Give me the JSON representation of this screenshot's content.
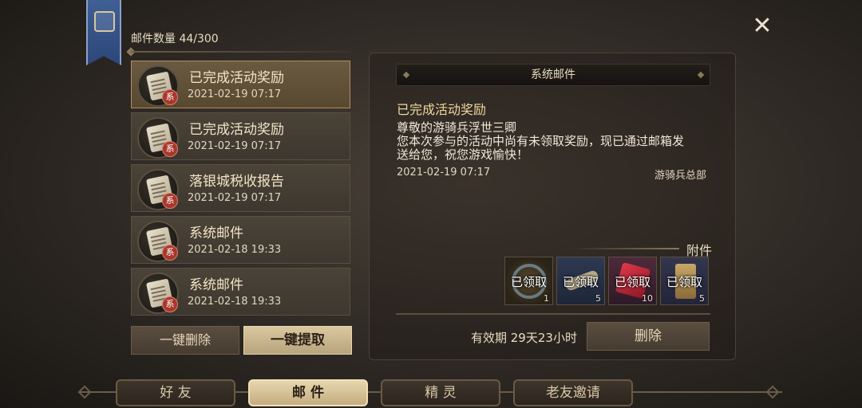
{
  "mail_count": "邮件数量 44/300",
  "mail_list": [
    {
      "title": "已完成活动奖励",
      "date": "2021-02-19 07:17",
      "badge": "系"
    },
    {
      "title": "已完成活动奖励",
      "date": "2021-02-19 07:17",
      "badge": "系"
    },
    {
      "title": "落银城税收报告",
      "date": "2021-02-19 07:17",
      "badge": "系"
    },
    {
      "title": "系统邮件",
      "date": "2021-02-18 19:33",
      "badge": "系"
    },
    {
      "title": "系统邮件",
      "date": "2021-02-18 19:33",
      "badge": "系"
    }
  ],
  "list_buttons": {
    "delete_all": "一键删除",
    "claim_all": "一键提取"
  },
  "detail": {
    "header": "系统邮件",
    "title": "已完成活动奖励",
    "body": [
      "尊敬的游骑兵浮世三卿",
      "您本次参与的活动中尚有未领取奖励，现已通过邮箱发",
      "送给您，祝您游戏愉快！"
    ],
    "date": "2021-02-19 07:17",
    "sender": "游骑兵总部",
    "attachment_label": "附件",
    "rewards": [
      {
        "status": "已领取",
        "qty": "1",
        "icon": "ring-icon",
        "color": "#3a3020"
      },
      {
        "status": "已领取",
        "qty": "5",
        "icon": "scroll-item-icon",
        "color": "#2a3548"
      },
      {
        "status": "已领取",
        "qty": "10",
        "icon": "gem-icon",
        "color": "#4a2838"
      },
      {
        "status": "已领取",
        "qty": "5",
        "icon": "parchment-icon",
        "color": "#2e3044"
      }
    ],
    "validity": "有效期 29天23小时",
    "delete": "删除"
  },
  "tabs": [
    {
      "label": "好 友",
      "active": false
    },
    {
      "label": "邮 件",
      "active": true
    },
    {
      "label": "精 灵",
      "active": false
    },
    {
      "label": "老友邀请",
      "active": false
    }
  ],
  "close_symbol": "✕"
}
